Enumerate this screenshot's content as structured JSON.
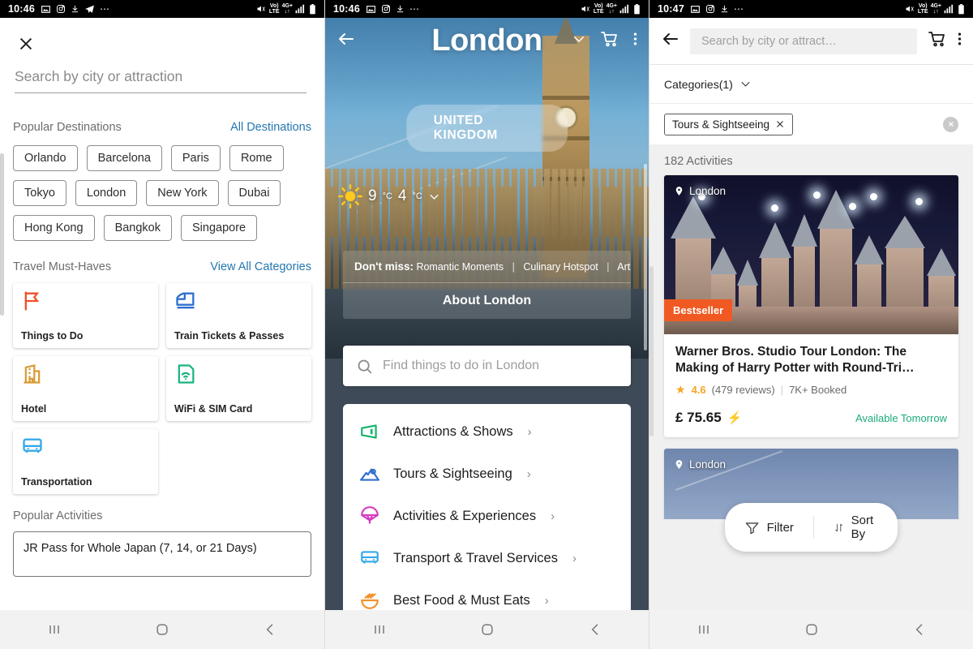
{
  "status_bar": {
    "time_left": "10:46",
    "time_right": "10:47",
    "icons": [
      "image-icon",
      "instagram-icon",
      "download-icon",
      "telegram-icon",
      "more-icon"
    ],
    "network": "VoLTE",
    "network2": "4G+"
  },
  "nav_bar": {
    "recents": "recents-icon",
    "home": "home-icon",
    "back": "back-icon"
  },
  "screen1": {
    "close_label": "✕",
    "search": {
      "placeholder": "Search by city or attraction",
      "value": ""
    },
    "popular_destinations": {
      "title": "Popular Destinations",
      "link": "All Destinations",
      "chips": [
        "Orlando",
        "Barcelona",
        "Paris",
        "Rome",
        "Tokyo",
        "London",
        "New York",
        "Dubai",
        "Hong Kong",
        "Bangkok",
        "Singapore"
      ]
    },
    "travel_must_haves": {
      "title": "Travel Must-Haves",
      "link": "View All Categories",
      "cards": [
        {
          "label": "Things to Do",
          "icon": "flag-icon",
          "color": "#f0502a"
        },
        {
          "label": "Train Tickets & Passes",
          "icon": "train-icon",
          "color": "#2f6fd0"
        },
        {
          "label": "Hotel",
          "icon": "hotel-icon",
          "color": "#d99a32"
        },
        {
          "label": "WiFi & SIM Card",
          "icon": "wifi-icon",
          "color": "#18b57e"
        },
        {
          "label": "Transportation",
          "icon": "bus-icon",
          "color": "#35a9e8"
        }
      ]
    },
    "popular_activities": {
      "title": "Popular Activities",
      "items": [
        "JR Pass for Whole Japan (7, 14, or 21 Days)"
      ]
    }
  },
  "screen2": {
    "title": "London",
    "country_badge": "UNITED KINGDOM",
    "back_icon": "back-arrow-icon",
    "cart_icon": "cart-icon",
    "menu_icon": "more-vertical-icon",
    "weather": {
      "icon": "sun-icon",
      "high": "9",
      "low": "4",
      "unit": "°C",
      "chevron": "chevron-down-icon"
    },
    "dont_miss": {
      "label": "Don't miss:",
      "items": [
        "Romantic Moments",
        "Culinary Hotspot",
        "Arts and…"
      ],
      "about": "About London"
    },
    "search": {
      "placeholder": "Find things to do in London",
      "icon": "search-icon"
    },
    "menu": [
      {
        "label": "Attractions & Shows",
        "icon": "ticket-icon",
        "color": "#14b36b"
      },
      {
        "label": "Tours & Sightseeing",
        "icon": "mountain-icon",
        "color": "#2f6fd0"
      },
      {
        "label": "Activities & Experiences",
        "icon": "parachute-icon",
        "color": "#d43ec0"
      },
      {
        "label": "Transport & Travel Services",
        "icon": "bus-icon",
        "color": "#35a9e8"
      },
      {
        "label": "Best Food & Must Eats",
        "icon": "noodles-icon",
        "color": "#f2922a"
      }
    ]
  },
  "screen3": {
    "back_icon": "back-arrow-icon",
    "search": {
      "placeholder": "Search by city or attract…",
      "value": ""
    },
    "cart_icon": "cart-icon",
    "menu_icon": "more-vertical-icon",
    "categories_label": "Categories(1)",
    "filter_chip": {
      "label": "Tours & Sightseeing",
      "remove": "✕"
    },
    "clear_all": "✕",
    "result_count": "182 Activities",
    "cards": [
      {
        "location": "London",
        "badge": "Bestseller",
        "title": "Warner Bros. Studio Tour London: The Making of Harry Potter with Round-Tri…",
        "rating": "4.6",
        "reviews": "(479 reviews)",
        "booked": "7K+ Booked",
        "price": "£ 75.65",
        "availability": "Available Tomorrow"
      },
      {
        "location": "London"
      }
    ],
    "fab": {
      "filter": "Filter",
      "filter_icon": "funnel-icon",
      "sort": "Sort By",
      "sort_icon": "sort-icon"
    }
  }
}
